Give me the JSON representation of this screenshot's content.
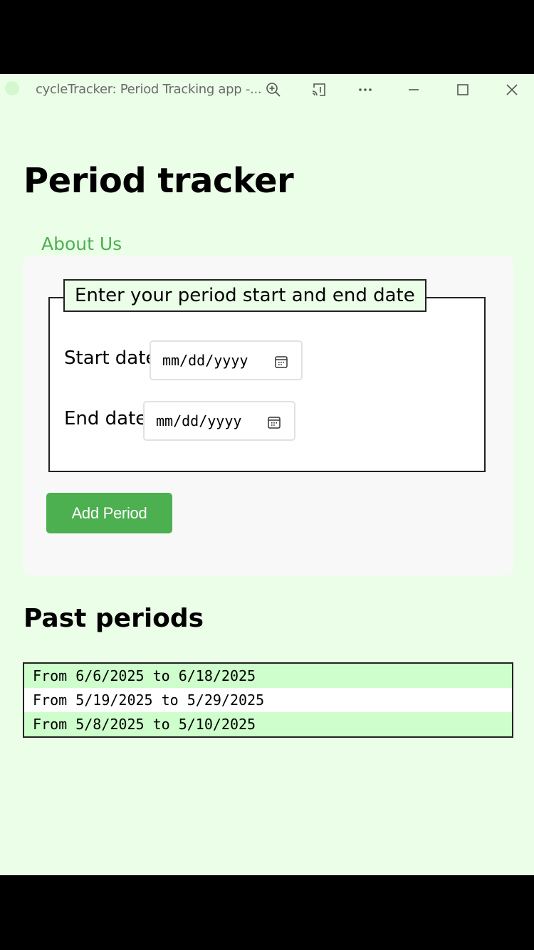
{
  "window": {
    "title": "cycleTracker: Period Tracking app -..."
  },
  "icons": {
    "zoom": "zoom-in-icon",
    "cast": "cast-icon",
    "more": "more-icon",
    "minimize": "minimize-icon",
    "maximize": "maximize-icon",
    "close": "close-icon",
    "calendar": "calendar-icon"
  },
  "colors": {
    "background": "#ebffe8",
    "accent": "#4caf50",
    "row_highlight": "#cdfecb"
  },
  "page": {
    "title": "Period tracker",
    "about_link": "About Us"
  },
  "form": {
    "legend": "Enter your period start and end date",
    "start_label": "Start date",
    "start_value": "mm/dd/yyyy",
    "end_label": "End date",
    "end_value": "mm/dd/yyyy",
    "submit_label": "Add Period"
  },
  "past": {
    "heading": "Past periods",
    "items": [
      "From 6/6/2025 to 6/18/2025",
      "From 5/19/2025 to 5/29/2025",
      "From 5/8/2025 to 5/10/2025"
    ]
  }
}
